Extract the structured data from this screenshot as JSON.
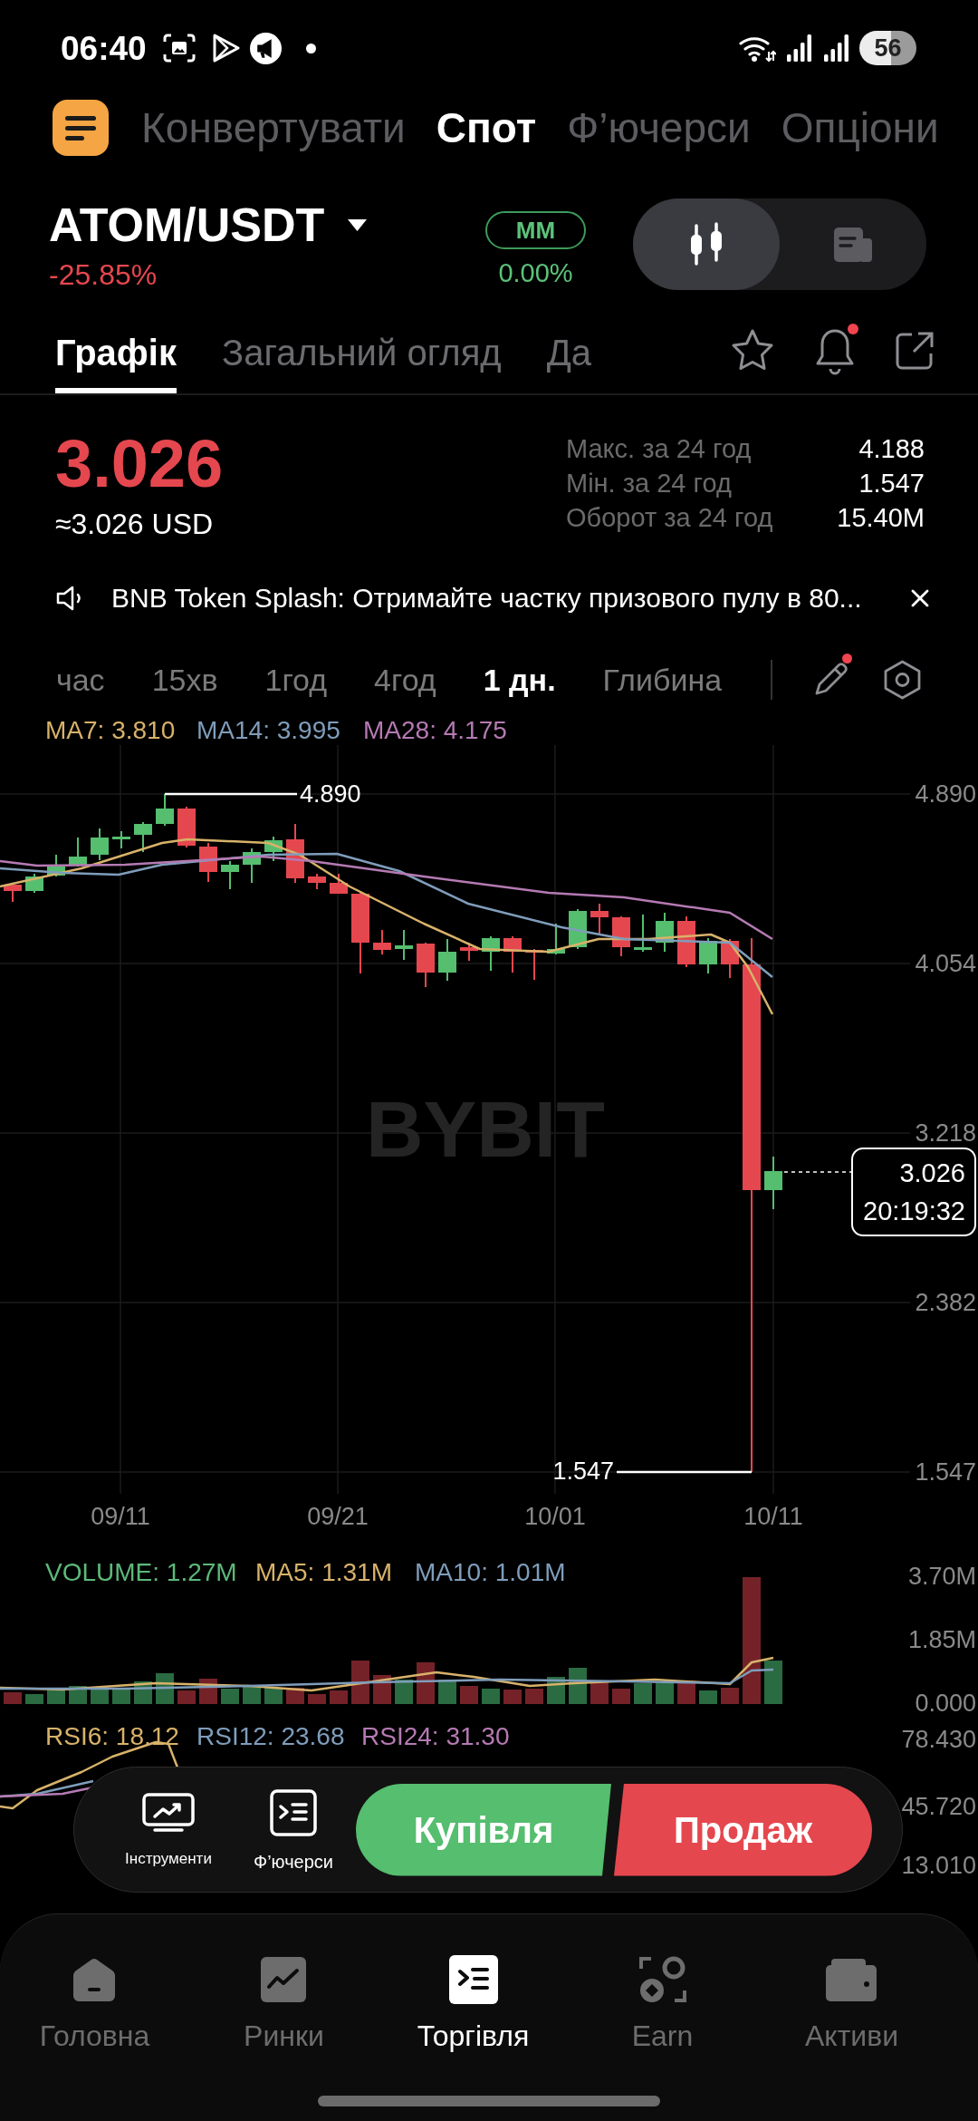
{
  "status_bar": {
    "time": "06:40",
    "battery": "56"
  },
  "top_tabs": [
    {
      "label": "Конвертувати",
      "selected": false
    },
    {
      "label": "Спот",
      "selected": true
    },
    {
      "label": "Ф’ючерси",
      "selected": false
    },
    {
      "label": "Опціони",
      "selected": false
    }
  ],
  "pair": {
    "symbol": "ATOM/USDT",
    "change": "-25.85%",
    "mm_label": "MM",
    "mm_value": "0.00%"
  },
  "view_toggle": [
    {
      "kind": "chart",
      "selected": true
    },
    {
      "kind": "document",
      "selected": false
    }
  ],
  "detail_tabs": [
    {
      "label": "Графік",
      "selected": true
    },
    {
      "label": "Загальний огляд",
      "selected": false
    },
    {
      "label": "Да",
      "selected": false
    }
  ],
  "header_actions": [
    {
      "kind": "star",
      "badge": false
    },
    {
      "kind": "bell",
      "badge": true
    },
    {
      "kind": "share",
      "badge": false
    }
  ],
  "price": {
    "last": "3.026",
    "fiat": "≈3.026 USD",
    "stats": [
      {
        "label": "Макс. за 24 год",
        "value": "4.188"
      },
      {
        "label": "Мін. за 24 год",
        "value": "1.547"
      },
      {
        "label": "Оборот за 24 год",
        "value": "15.40M"
      }
    ]
  },
  "announcement": {
    "text": "BNB Token Splash: Отримайте частку призового пулу в 80..."
  },
  "intervals": [
    {
      "label": "час",
      "selected": false
    },
    {
      "label": "15хв",
      "selected": false
    },
    {
      "label": "1год",
      "selected": false
    },
    {
      "label": "4год",
      "selected": false
    },
    {
      "label": "1 дн.",
      "selected": true
    },
    {
      "label": "Глибина",
      "selected": false
    }
  ],
  "chart_tools": [
    {
      "kind": "pencil",
      "badge": true
    },
    {
      "kind": "settings",
      "badge": false
    }
  ],
  "main_chart": {
    "indicators": [
      {
        "text": "MA7: 3.810",
        "color": "#d8b26a"
      },
      {
        "text": "MA14: 3.995",
        "color": "#7f9dbb"
      },
      {
        "text": "MA28: 4.175",
        "color": "#b57ab3"
      }
    ],
    "watermark": "BYBIT",
    "y_axis": [
      "4.890",
      "4.054",
      "3.218",
      "2.382",
      "1.547"
    ],
    "x_axis": [
      "09/11",
      "09/21",
      "10/01",
      "10/11"
    ],
    "high_label": "4.890",
    "low_label": "1.547",
    "price_tag": {
      "price": "3.026",
      "countdown": "20:19:32"
    }
  },
  "volume_chart": {
    "indicators": [
      {
        "text": "VOLUME: 1.27M",
        "color": "#5cb97a"
      },
      {
        "text": "MA5: 1.31M",
        "color": "#d8b26a"
      },
      {
        "text": "MA10: 1.01M",
        "color": "#7f9dbb"
      }
    ],
    "y_axis": [
      "3.70M",
      "1.85M",
      "0.000"
    ]
  },
  "rsi_chart": {
    "indicators": [
      {
        "text": "RSI6: 18.12",
        "color": "#d8b26a"
      },
      {
        "text": "RSI12: 23.68",
        "color": "#7f9dbb"
      },
      {
        "text": "RSI24: 31.30",
        "color": "#b57ab3"
      }
    ],
    "y_axis": [
      "78.430",
      "45.720",
      "13.010"
    ]
  },
  "action_bar": {
    "shortcuts": [
      {
        "kind": "tools",
        "label": "Інструменти"
      },
      {
        "kind": "futures",
        "label": "Ф’ючерси"
      }
    ],
    "buy": "Купівля",
    "sell": "Продаж"
  },
  "bottom_nav": [
    {
      "kind": "home",
      "label": "Головна",
      "selected": false
    },
    {
      "kind": "markets",
      "label": "Ринки",
      "selected": false
    },
    {
      "kind": "trade",
      "label": "Торгівля",
      "selected": true
    },
    {
      "kind": "earn",
      "label": "Earn",
      "selected": false
    },
    {
      "kind": "assets",
      "label": "Активи",
      "selected": false
    }
  ]
}
